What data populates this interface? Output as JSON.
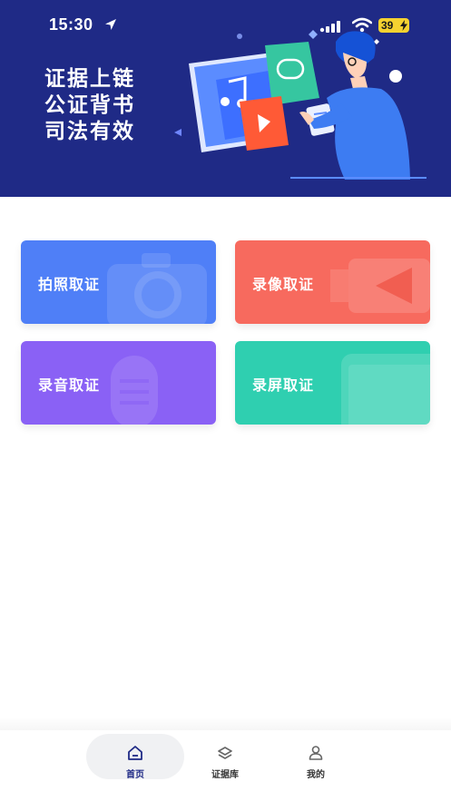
{
  "status_bar": {
    "time": "15:30",
    "battery": "39"
  },
  "banner": {
    "slogan_lines": [
      "证据上链",
      "公证背书",
      "司法有效"
    ]
  },
  "cards": [
    {
      "label": "拍照取证",
      "icon": "camera-icon",
      "color": "#4f7ff7"
    },
    {
      "label": "录像取证",
      "icon": "video-camera-icon",
      "color": "#f76a5e"
    },
    {
      "label": "录音取证",
      "icon": "microphone-icon",
      "color": "#8a61f5"
    },
    {
      "label": "录屏取证",
      "icon": "phone-screen-icon",
      "color": "#2fcfb0"
    }
  ],
  "bottom_nav": {
    "items": [
      {
        "label": "首页",
        "icon": "home-icon",
        "active": true
      },
      {
        "label": "证据库",
        "icon": "layers-icon",
        "active": false
      },
      {
        "label": "我的",
        "icon": "user-icon",
        "active": false
      }
    ]
  },
  "colors": {
    "banner_bg": "#1f2a86",
    "accent": "#1f2a86"
  }
}
